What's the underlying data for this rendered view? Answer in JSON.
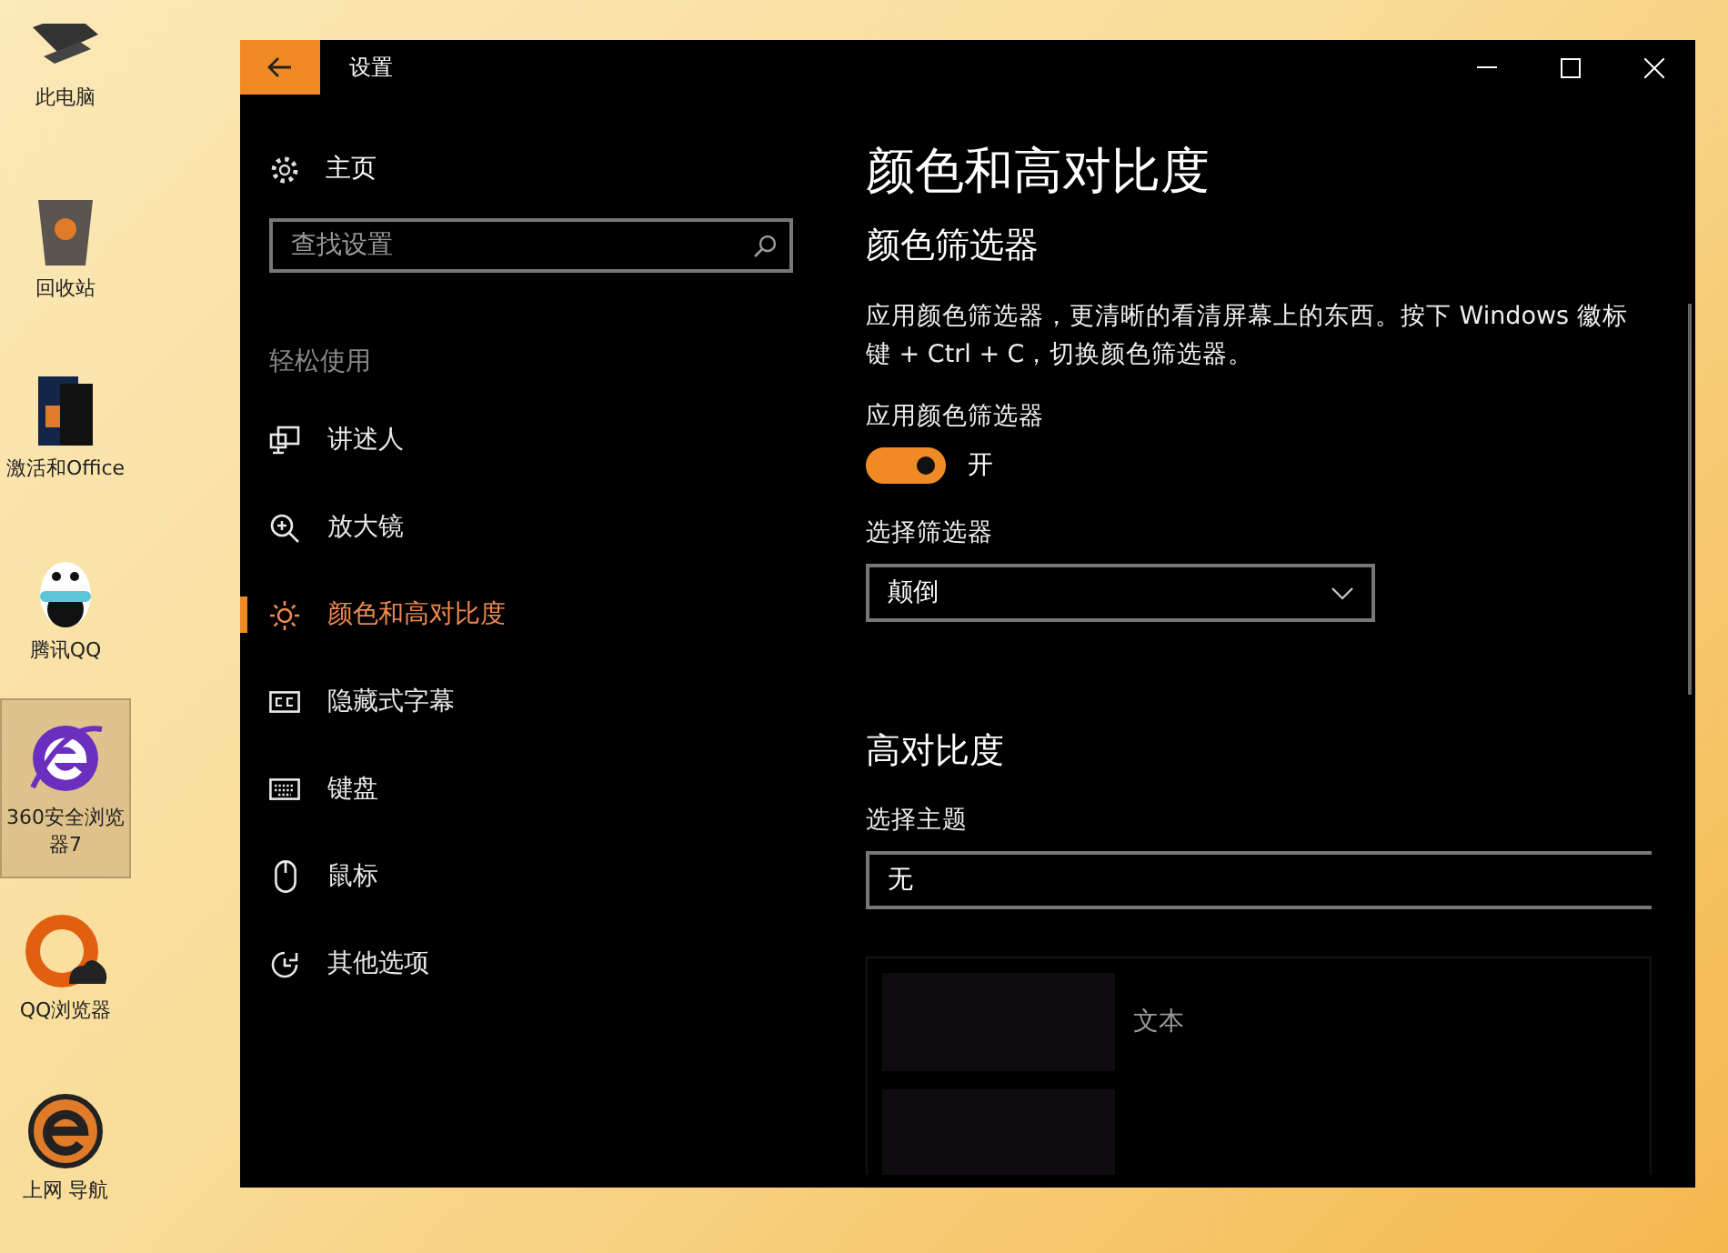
{
  "desktop_icons": [
    {
      "label": "此电脑",
      "selected": false
    },
    {
      "label": "回收站",
      "selected": false
    },
    {
      "label": "激活和Office",
      "selected": false
    },
    {
      "label": "腾讯QQ",
      "selected": false
    },
    {
      "label": "360安全浏览器7",
      "selected": true
    },
    {
      "label": "QQ浏览器",
      "selected": false
    },
    {
      "label": "上网 导航",
      "selected": false
    }
  ],
  "window": {
    "title": "设置"
  },
  "sidebar": {
    "home": "主页",
    "search": {
      "placeholder": "查找设置"
    },
    "section": "轻松使用",
    "items": [
      {
        "label": "讲述人",
        "selected": false
      },
      {
        "label": "放大镜",
        "selected": false
      },
      {
        "label": "颜色和高对比度",
        "selected": true
      },
      {
        "label": "隐藏式字幕",
        "selected": false
      },
      {
        "label": "键盘",
        "selected": false
      },
      {
        "label": "鼠标",
        "selected": false
      },
      {
        "label": "其他选项",
        "selected": false
      }
    ]
  },
  "content": {
    "title": "颜色和高对比度",
    "color_filter": {
      "heading": "颜色筛选器",
      "description": "应用颜色筛选器，更清晰的看清屏幕上的东西。按下 Windows 徽标键 + Ctrl + C，切换颜色筛选器。",
      "toggle_label": "应用颜色筛选器",
      "toggle": {
        "on": true,
        "state_text": "开"
      },
      "select_label": "选择筛选器",
      "select_value": "颠倒"
    },
    "high_contrast": {
      "heading": "高对比度",
      "select_label": "选择主题",
      "select_value": "无",
      "preview_text": "文本"
    }
  }
}
